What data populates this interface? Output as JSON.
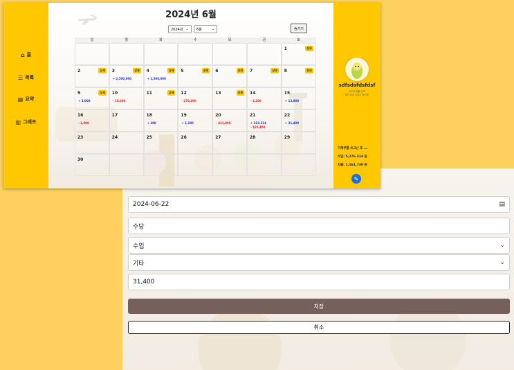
{
  "sidebar": {
    "items": [
      {
        "icon": "home-icon",
        "glyph": "⌂",
        "label": "홈"
      },
      {
        "icon": "list-icon",
        "glyph": "☰",
        "label": "목록"
      },
      {
        "icon": "clipboard-icon",
        "glyph": "▤",
        "label": "요약"
      },
      {
        "icon": "chart-icon",
        "glyph": "▥",
        "label": "그래프"
      }
    ]
  },
  "calendar": {
    "title": "2024년 6월",
    "year_select": "2024년",
    "month_select": "6월",
    "hide_label": "숨기기",
    "weekdays": [
      "일",
      "월",
      "화",
      "수",
      "목",
      "금",
      "토"
    ],
    "chip_label": "상세",
    "weeks": [
      [
        {
          "day": "",
          "chip": false,
          "amounts": []
        },
        {
          "day": "",
          "chip": false,
          "amounts": []
        },
        {
          "day": "",
          "chip": false,
          "amounts": []
        },
        {
          "day": "",
          "chip": false,
          "amounts": []
        },
        {
          "day": "",
          "chip": false,
          "amounts": []
        },
        {
          "day": "",
          "chip": false,
          "amounts": []
        },
        {
          "day": "1",
          "chip": true,
          "amounts": []
        }
      ],
      [
        {
          "day": "2",
          "chip": true,
          "amounts": []
        },
        {
          "day": "3",
          "chip": true,
          "amounts": [
            {
              "text": "+ 2,500,000",
              "type": "pos"
            }
          ]
        },
        {
          "day": "4",
          "chip": true,
          "amounts": [
            {
              "text": "+ 2,500,000",
              "type": "pos"
            }
          ]
        },
        {
          "day": "5",
          "chip": true,
          "amounts": []
        },
        {
          "day": "6",
          "chip": true,
          "amounts": []
        },
        {
          "day": "7",
          "chip": true,
          "amounts": []
        },
        {
          "day": "8",
          "chip": true,
          "amounts": []
        }
      ],
      [
        {
          "day": "9",
          "chip": true,
          "amounts": [
            {
              "text": "+ 3,000",
              "type": "pos"
            }
          ]
        },
        {
          "day": "10",
          "chip": false,
          "amounts": [
            {
              "text": "- 10,000",
              "type": "neg"
            }
          ]
        },
        {
          "day": "11",
          "chip": true,
          "amounts": []
        },
        {
          "day": "12",
          "chip": false,
          "amounts": [
            {
              "text": "- 270,000",
              "type": "neg"
            }
          ]
        },
        {
          "day": "13",
          "chip": true,
          "amounts": []
        },
        {
          "day": "14",
          "chip": false,
          "amounts": [
            {
              "text": "- 3,200",
              "type": "neg"
            }
          ]
        },
        {
          "day": "15",
          "chip": false,
          "amounts": [
            {
              "text": "+ 13,000",
              "type": "pos"
            }
          ]
        }
      ],
      [
        {
          "day": "16",
          "chip": false,
          "amounts": [
            {
              "text": "- 1,000",
              "type": "neg"
            }
          ]
        },
        {
          "day": "17",
          "chip": false,
          "amounts": []
        },
        {
          "day": "18",
          "chip": false,
          "amounts": [
            {
              "text": "+ 280",
              "type": "pos"
            }
          ]
        },
        {
          "day": "19",
          "chip": false,
          "amounts": [
            {
              "text": "+ 1,100",
              "type": "pos"
            }
          ]
        },
        {
          "day": "20",
          "chip": false,
          "amounts": [
            {
              "text": "- 431,000",
              "type": "neg"
            }
          ]
        },
        {
          "day": "21",
          "chip": false,
          "amounts": [
            {
              "text": "+ 223,314",
              "type": "pos"
            },
            {
              "text": "- 125,450",
              "type": "neg"
            }
          ]
        },
        {
          "day": "22",
          "chip": false,
          "amounts": [
            {
              "text": "+ 31,400",
              "type": "pos"
            }
          ]
        }
      ],
      [
        {
          "day": "23",
          "chip": false,
          "amounts": []
        },
        {
          "day": "24",
          "chip": false,
          "amounts": []
        },
        {
          "day": "25",
          "chip": false,
          "amounts": []
        },
        {
          "day": "26",
          "chip": false,
          "amounts": []
        },
        {
          "day": "27",
          "chip": false,
          "amounts": []
        },
        {
          "day": "28",
          "chip": false,
          "amounts": []
        },
        {
          "day": "29",
          "chip": false,
          "amounts": []
        }
      ],
      [
        {
          "day": "30",
          "chip": false,
          "amounts": []
        },
        {
          "day": "",
          "chip": false,
          "amounts": []
        },
        {
          "day": "",
          "chip": false,
          "amounts": []
        },
        {
          "day": "",
          "chip": false,
          "amounts": []
        },
        {
          "day": "",
          "chip": false,
          "amounts": []
        },
        {
          "day": "",
          "chip": false,
          "amounts": []
        },
        {
          "day": "",
          "chip": false,
          "amounts": []
        }
      ]
    ]
  },
  "profile": {
    "name": "sdfsdsfdsfdsf",
    "desc_line1": "자기소개를 입력",
    "desc_line2": "해주세요 오늘도 화이팅",
    "budget_text": "가계부를 쓰고난 후 ...",
    "income_text": "수입: 5,276,314 원",
    "expense_text": "지출: 1,161,730 원"
  },
  "form": {
    "date_value": "2024-06-22",
    "memo_value": "수당",
    "type_value": "수입",
    "category_value": "기타",
    "amount_value": "31,400",
    "save_label": "저장",
    "cancel_label": "취소"
  },
  "colors": {
    "accent_yellow": "#ffc800",
    "save_brown": "#775f5c",
    "income_blue": "#2233cc",
    "expense_red": "#ee2222"
  }
}
